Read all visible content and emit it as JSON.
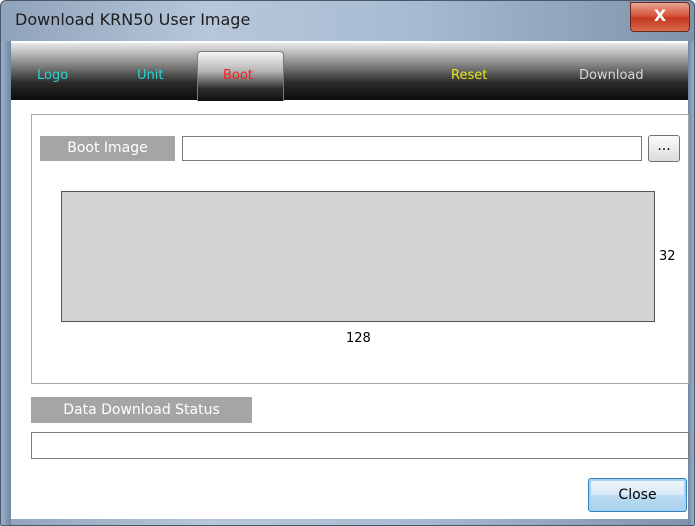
{
  "window": {
    "title": "Download KRN50 User Image",
    "close_glyph": "X"
  },
  "tabs": [
    {
      "label": "Logo",
      "color": "#2ad4d4"
    },
    {
      "label": "Unit",
      "color": "#2ad4d4"
    },
    {
      "label": "Boot",
      "color": "#ff1a1a",
      "active": true
    },
    {
      "label": "Reset",
      "color": "#e8e81a"
    },
    {
      "label": "Download",
      "color": "#d8d8d8"
    }
  ],
  "boot": {
    "label": "Boot Image",
    "path_value": "",
    "browse_label": "...",
    "width_label": "128",
    "height_label": "32"
  },
  "status": {
    "label": "Data Download Status",
    "value": ""
  },
  "buttons": {
    "close_label": "Close"
  }
}
